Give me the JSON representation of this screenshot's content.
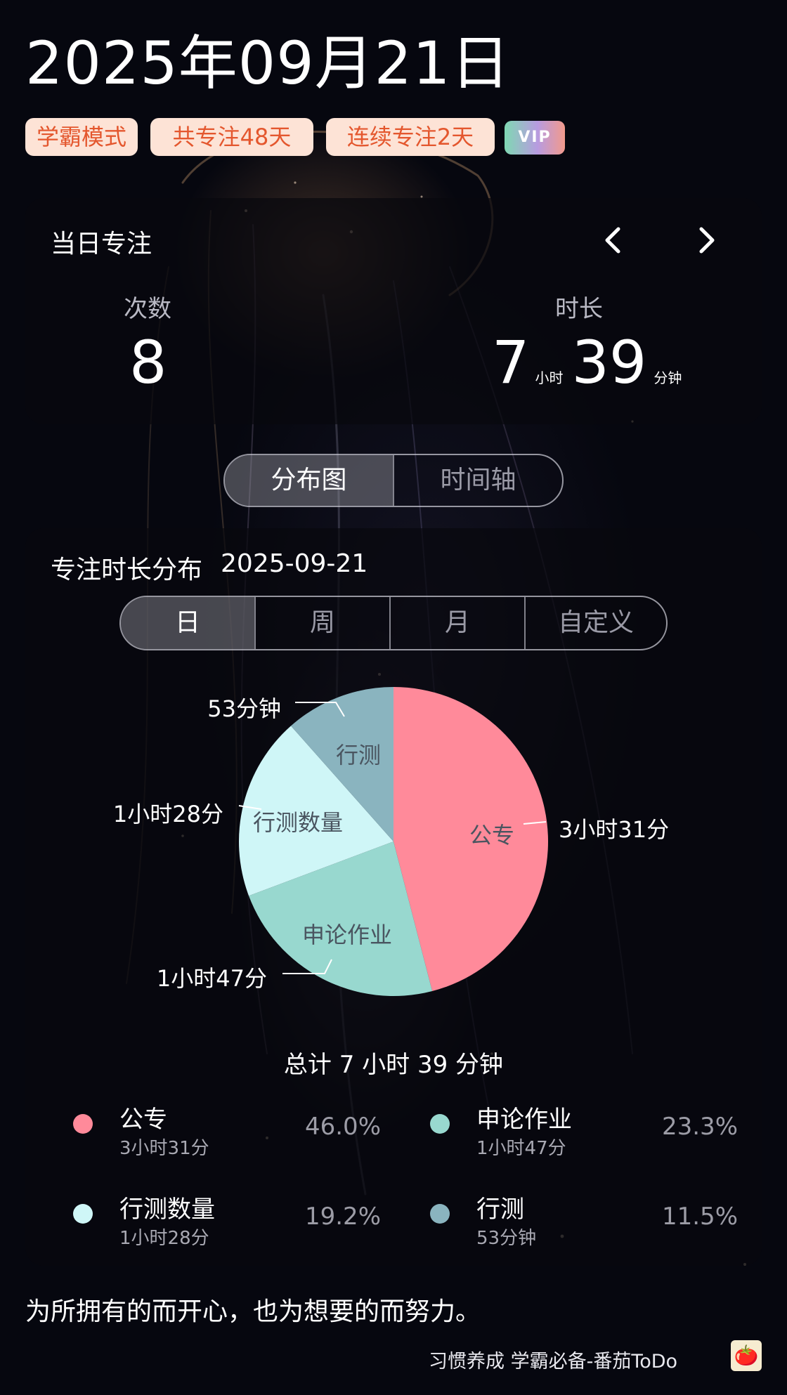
{
  "header": {
    "date": "2025年09月21日",
    "badges": [
      "学霸模式",
      "共专注48天",
      "连续专注2天"
    ],
    "vip_label": "VIP"
  },
  "daily": {
    "title": "当日专注",
    "count_label": "次数",
    "count_value": "8",
    "duration_label": "时长",
    "hours_value": "7",
    "hours_unit": "小时",
    "minutes_value": "39",
    "minutes_unit": "分钟"
  },
  "view_tabs": [
    "分布图",
    "时间轴"
  ],
  "distribution": {
    "title": "专注时长分布",
    "date": "2025-09-21",
    "range_tabs": [
      "日",
      "周",
      "月",
      "自定义"
    ],
    "total_text": "总计 7 小时 39 分钟"
  },
  "colors": {
    "gongzhuan": "#ff8a9a",
    "shenlun": "#98d8cf",
    "xingce_count": "#cff6f7",
    "xingce": "#8ab4bf"
  },
  "chart_data": {
    "type": "pie",
    "slices": [
      {
        "name": "公专",
        "minutes": 211,
        "time_label": "3小时31分",
        "percent": "46.0%",
        "color": "#ff8a9a"
      },
      {
        "name": "申论作业",
        "minutes": 107,
        "time_label": "1小时47分",
        "percent": "23.3%",
        "color": "#98d8cf"
      },
      {
        "name": "行测数量",
        "minutes": 88,
        "time_label": "1小时28分",
        "percent": "19.2%",
        "color": "#cff6f7"
      },
      {
        "name": "行测",
        "minutes": 53,
        "time_label": "53分钟",
        "percent": "11.5%",
        "color": "#8ab4bf"
      }
    ]
  },
  "quote": "为所拥有的而开心，也为想要的而努力。",
  "footer": {
    "brand": "习惯养成 学霸必备-番茄ToDo",
    "icon": "tomato-icon"
  }
}
